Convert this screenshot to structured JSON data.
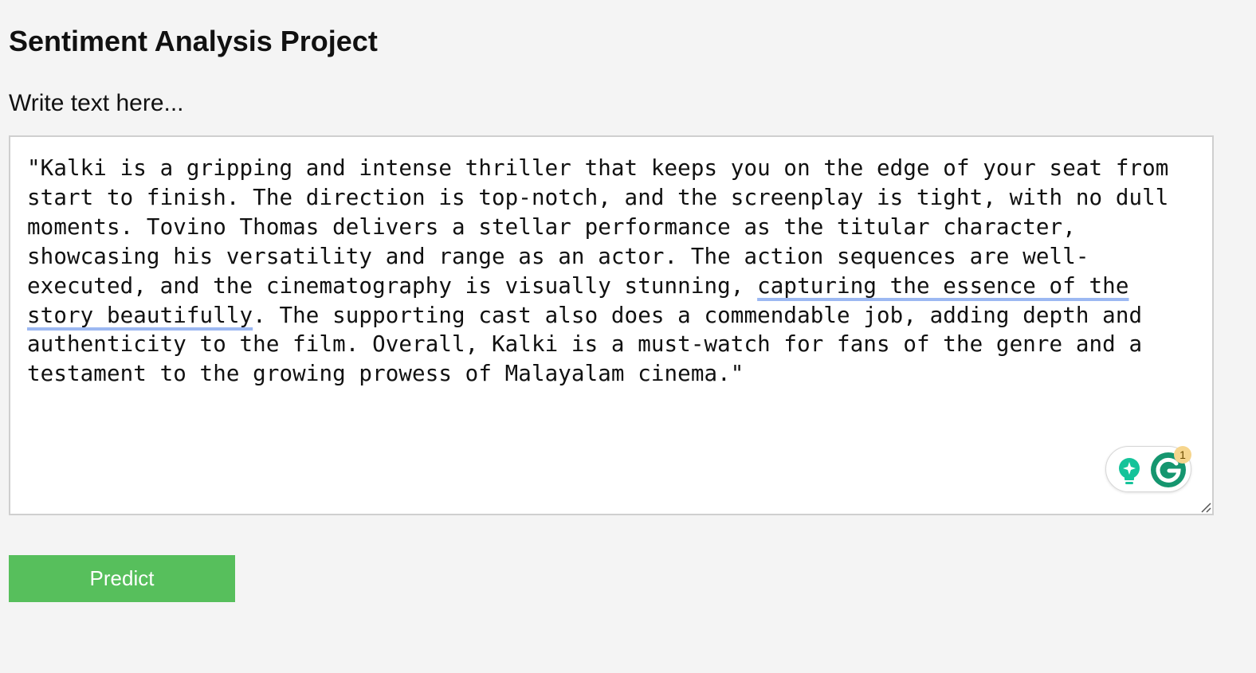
{
  "page": {
    "title": "Sentiment Analysis Project",
    "input_label": "Write text here..."
  },
  "editor": {
    "text_before": "\"Kalki is a gripping and intense thriller that keeps you on the edge of your seat from start to finish. The direction is top-notch, and the screenplay is tight, with no dull moments. Tovino Thomas delivers a stellar performance as the titular character, showcasing his versatility and range as an actor. The action sequences are well-executed, and the cinematography is visually stunning, ",
    "text_flagged": "capturing the essence of the story beautifully",
    "text_after": ". The supporting cast also does a commendable job, adding depth and authenticity to the film. Overall, Kalki is a must-watch for fans of the genre and a testament to the growing prowess of Malayalam cinema.\"",
    "underline_color": "#9cb8f2"
  },
  "grammarly": {
    "suggestion_count": "1",
    "icons": [
      "lightbulb-sparkle-icon",
      "grammarly-g-icon"
    ],
    "brand_color": "#15c39a",
    "badge_color": "#f6d58d"
  },
  "actions": {
    "predict_label": "Predict",
    "predict_color": "#57bf5c"
  }
}
